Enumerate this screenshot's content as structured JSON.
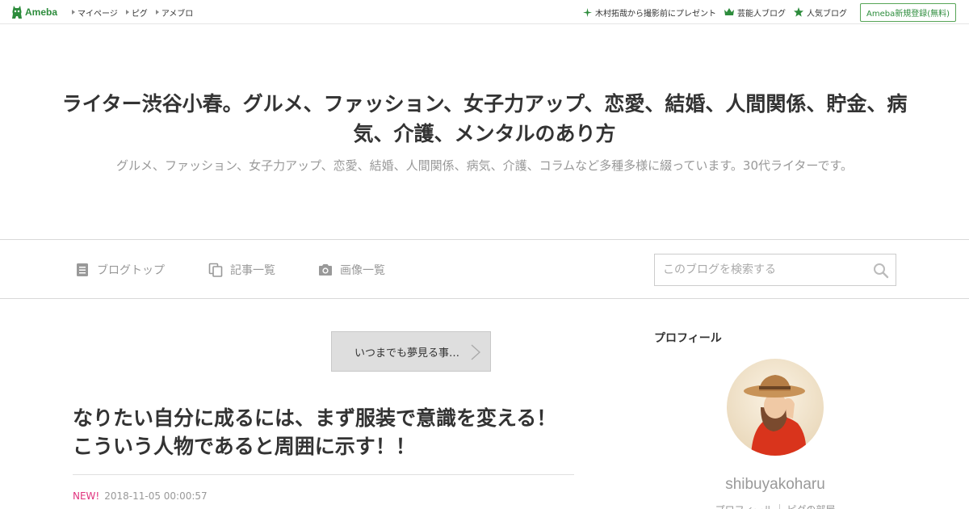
{
  "topbar": {
    "logo_text": "Ameba",
    "left_links": [
      "マイページ",
      "ピグ",
      "アメブロ"
    ],
    "right_links": [
      {
        "icon": "sparkle-icon",
        "label": "木村拓哉から撮影前にプレゼント"
      },
      {
        "icon": "crown-icon",
        "label": "芸能人ブログ"
      },
      {
        "icon": "star-icon",
        "label": "人気ブログ"
      }
    ],
    "register_label": "Ameba新規登録(無料)",
    "accent_color": "#2d8c3c"
  },
  "header": {
    "title": "ライター渋谷小春。グルメ、ファッション、女子力アップ、恋愛、結婚、人間関係、貯金、病気、介護、メンタルのあり方",
    "description": "グルメ、ファッション、女子力アップ、恋愛、結婚、人間関係、病気、介護、コラムなど多種多様に綴っています。30代ライターです。"
  },
  "nav": {
    "items": [
      {
        "icon": "document-icon",
        "label": "ブログトップ"
      },
      {
        "icon": "copy-icon",
        "label": "記事一覧"
      },
      {
        "icon": "camera-icon",
        "label": "画像一覧"
      }
    ],
    "search_placeholder": "このブログを検索する"
  },
  "main": {
    "pager_label": "いつまでも夢見る事…",
    "article": {
      "title": "なりたい自分に成るには、まず服装で意識を変える！こういう人物であると周囲に示す！！",
      "badge": "NEW!",
      "timestamp": "2018-11-05 00:00:57"
    }
  },
  "sidebar": {
    "profile_heading": "プロフィール",
    "username": "shibuyakoharu",
    "links": [
      "プロフィール",
      "ピグの部屋"
    ]
  }
}
